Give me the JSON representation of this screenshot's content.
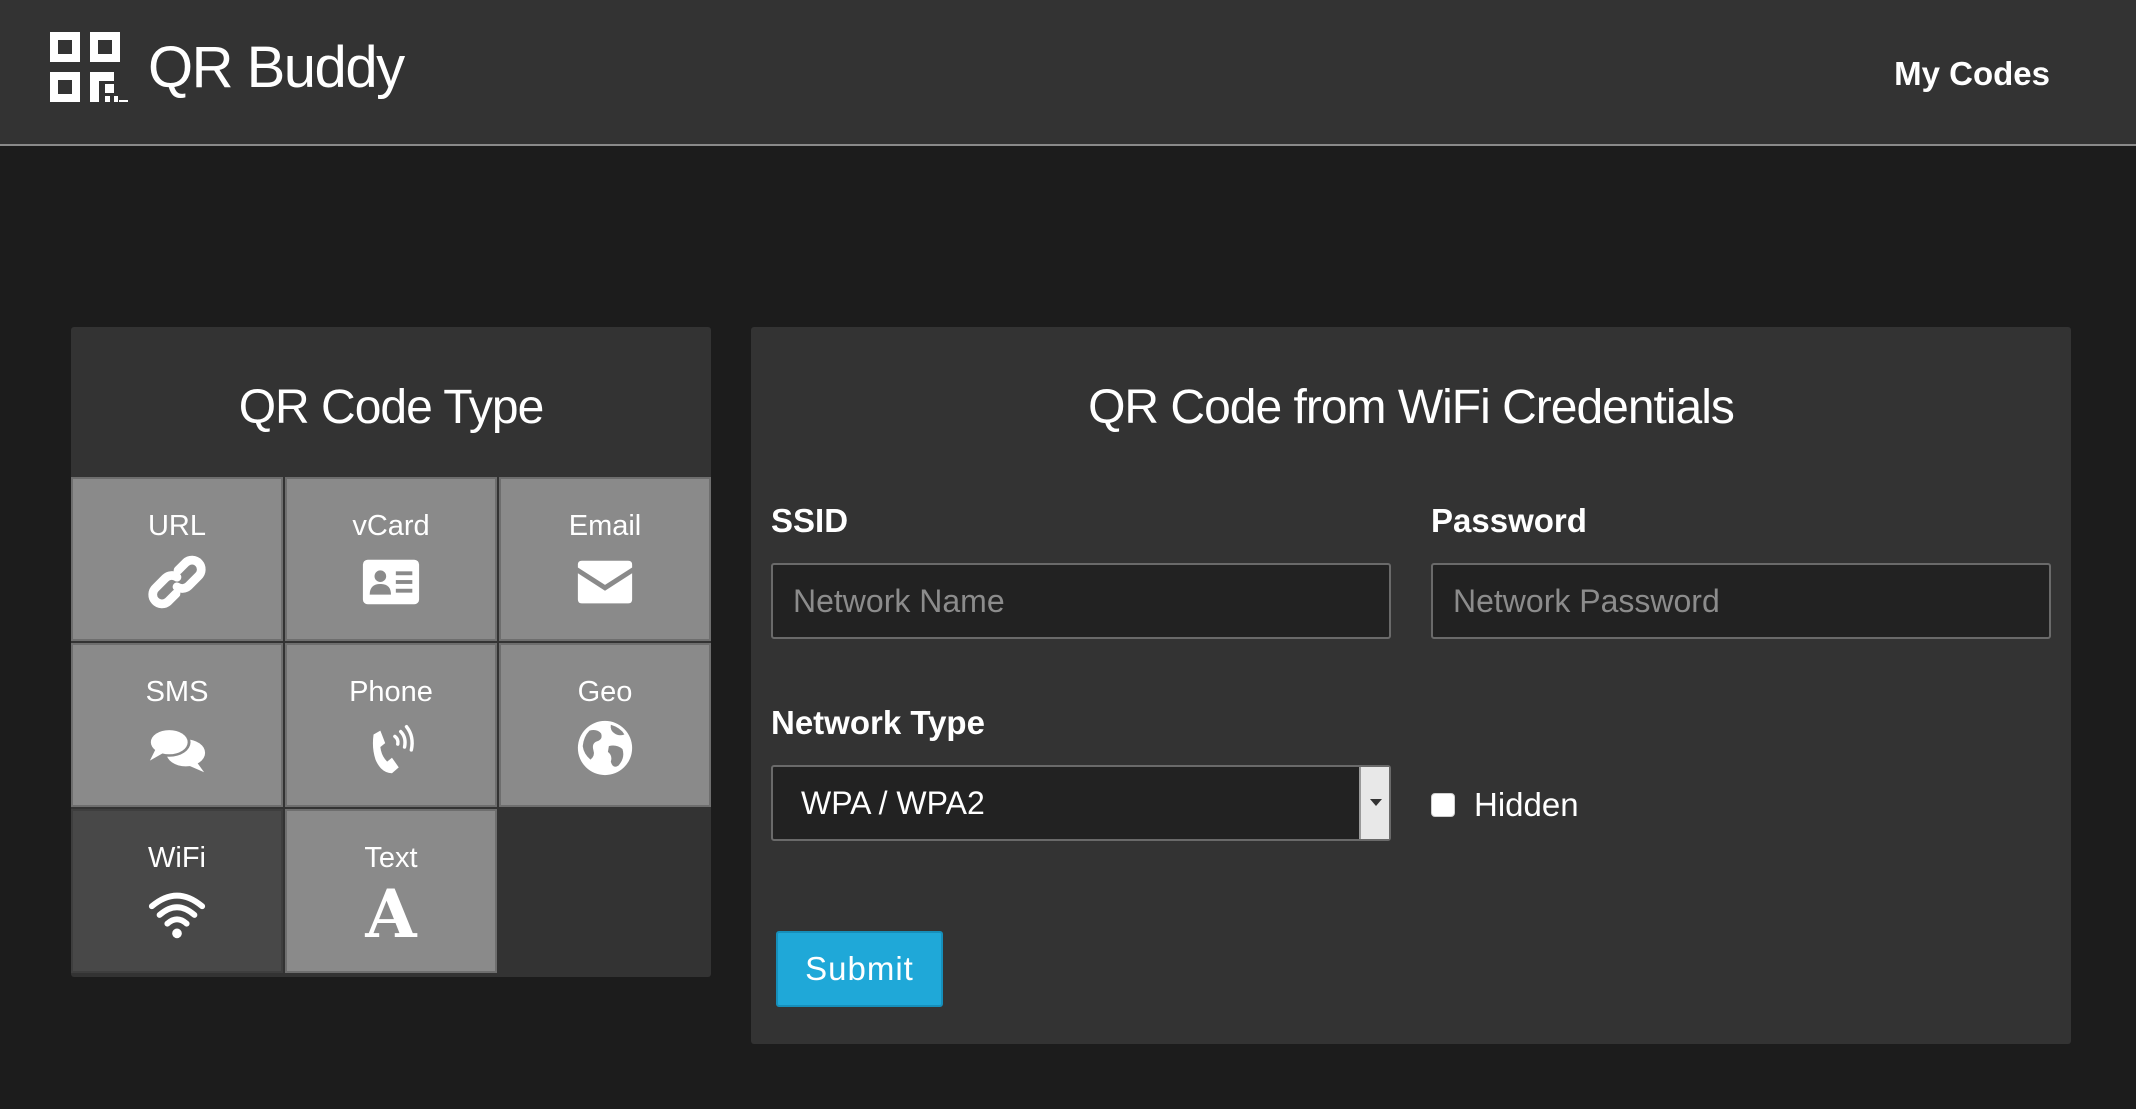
{
  "header": {
    "brand_name": "QR Buddy",
    "logo_icon": "qr-code-icon",
    "nav_link": "My Codes"
  },
  "type_panel": {
    "title": "QR Code Type",
    "types": [
      {
        "label": "URL",
        "icon": "link-icon"
      },
      {
        "label": "vCard",
        "icon": "id-card-icon"
      },
      {
        "label": "Email",
        "icon": "envelope-icon"
      },
      {
        "label": "SMS",
        "icon": "chat-bubbles-icon"
      },
      {
        "label": "Phone",
        "icon": "phone-icon"
      },
      {
        "label": "Geo",
        "icon": "globe-icon"
      },
      {
        "label": "WiFi",
        "icon": "wifi-icon",
        "active": true
      },
      {
        "label": "Text",
        "icon": "text-icon",
        "glyph": "A"
      }
    ]
  },
  "form": {
    "title": "QR Code from WiFi Credentials",
    "ssid_label": "SSID",
    "ssid_placeholder": "Network Name",
    "ssid_value": "",
    "password_label": "Password",
    "password_placeholder": "Network Password",
    "password_value": "",
    "network_type_label": "Network Type",
    "network_type_value": "WPA / WPA2",
    "hidden_label": "Hidden",
    "hidden_checked": false,
    "submit_label": "Submit"
  },
  "colors": {
    "background": "#1c1c1c",
    "panel": "#333333",
    "tile": "#8a8a8a",
    "tile_active": "#484848",
    "accent": "#1fa8d8"
  }
}
